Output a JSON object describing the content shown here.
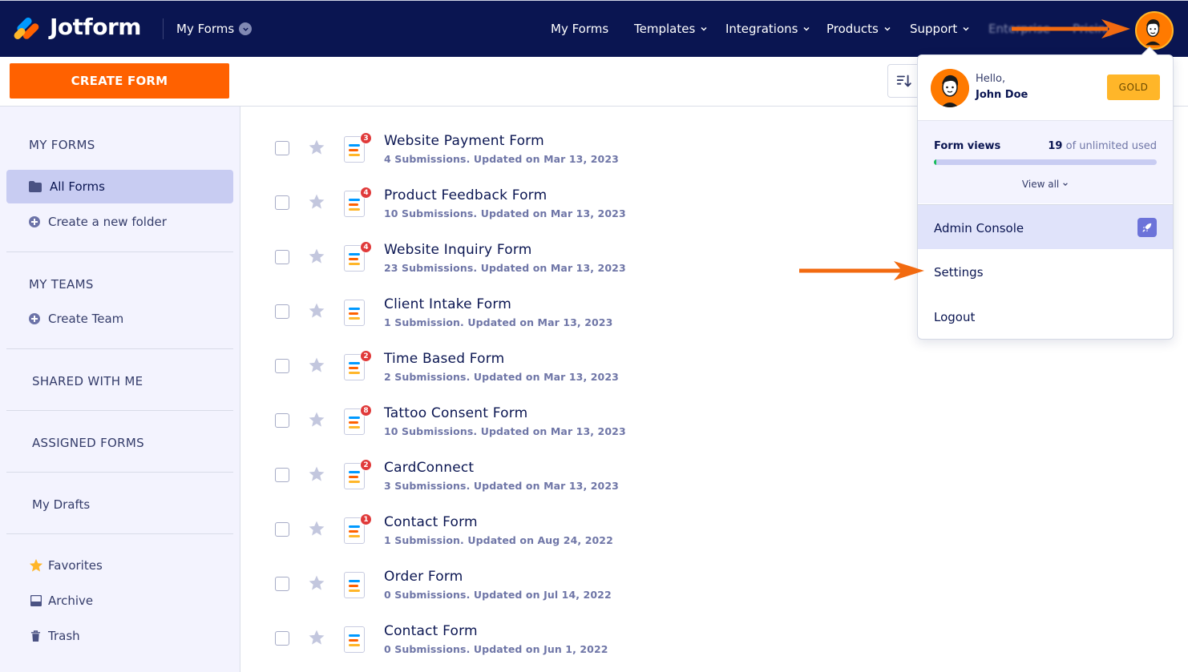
{
  "app": {
    "brand": "Jotform",
    "current_section": "My Forms"
  },
  "topnav": {
    "items": [
      {
        "label": "My Forms",
        "has_caret": false
      },
      {
        "label": "Templates",
        "has_caret": true
      },
      {
        "label": "Integrations",
        "has_caret": true
      },
      {
        "label": "Products",
        "has_caret": true
      },
      {
        "label": "Support",
        "has_caret": true
      },
      {
        "label": "Enterprise",
        "has_caret": false,
        "blurred": true
      },
      {
        "label": "Pricing",
        "has_caret": false,
        "blurred": true
      }
    ]
  },
  "toolbar": {
    "create_label": "CREATE FORM",
    "sort_icon": "sort-icon"
  },
  "sidebar": {
    "my_forms_title": "MY FORMS",
    "all_forms": "All Forms",
    "create_folder": "Create a new folder",
    "my_teams_title": "MY TEAMS",
    "create_team": "Create Team",
    "shared_title": "SHARED WITH ME",
    "assigned_title": "ASSIGNED FORMS",
    "drafts": "My Drafts",
    "favorites": "Favorites",
    "archive": "Archive",
    "trash": "Trash"
  },
  "forms": [
    {
      "title": "Website Payment Form",
      "subtitle": "4 Submissions. Updated on Mar 13, 2023",
      "badge": "3"
    },
    {
      "title": "Product Feedback Form",
      "subtitle": "10 Submissions. Updated on Mar 13, 2023",
      "badge": "4"
    },
    {
      "title": "Website Inquiry Form",
      "subtitle": "23 Submissions. Updated on Mar 13, 2023",
      "badge": "4"
    },
    {
      "title": "Client Intake Form",
      "subtitle": "1 Submission. Updated on Mar 13, 2023",
      "badge": ""
    },
    {
      "title": "Time Based Form",
      "subtitle": "2 Submissions. Updated on Mar 13, 2023",
      "badge": "2"
    },
    {
      "title": "Tattoo Consent Form",
      "subtitle": "10 Submissions. Updated on Mar 13, 2023",
      "badge": "8"
    },
    {
      "title": "CardConnect",
      "subtitle": "3 Submissions. Updated on Mar 13, 2023",
      "badge": "2"
    },
    {
      "title": "Contact Form",
      "subtitle": "1 Submission. Updated on Aug 24, 2022",
      "badge": "1"
    },
    {
      "title": "Order Form",
      "subtitle": "0 Submissions. Updated on Jul 14, 2022",
      "badge": ""
    },
    {
      "title": "Contact Form",
      "subtitle": "0 Submissions. Updated on Jun 1, 2022",
      "badge": ""
    }
  ],
  "account_menu": {
    "greeting": "Hello,",
    "user_name": "John Doe",
    "plan": "GOLD",
    "form_views_label": "Form views",
    "form_views_used": "19",
    "form_views_rest": " of unlimited used",
    "form_views_fraction": 0.01,
    "view_all": "View all",
    "admin_console": "Admin Console",
    "settings": "Settings",
    "logout": "Logout"
  },
  "colors": {
    "nav_bg": "#0a1551",
    "accent_orange": "#ff6100",
    "gold": "#ffb629",
    "sidebar_bg": "#f3f3fe",
    "badge_red": "#e03a3a"
  }
}
